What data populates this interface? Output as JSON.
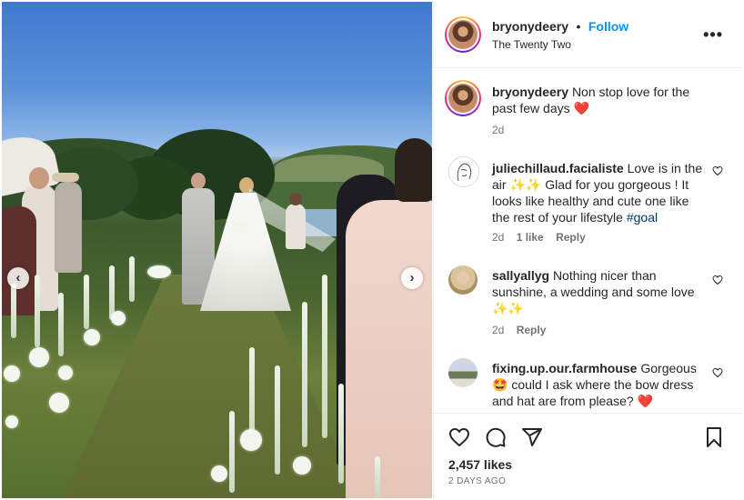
{
  "post": {
    "username": "bryonydeery",
    "separator": "•",
    "follow_label": "Follow",
    "location": "The Twenty Two",
    "more_label": "•••",
    "caption_text": "Non stop love for the past few days",
    "caption_emoji": "❤️",
    "caption_time": "2d"
  },
  "comments": [
    {
      "username": "juliechillaud.facialiste",
      "text": "Love is in the air ✨✨ Glad for you gorgeous ! It looks like healthy and cute one like the rest of your lifestyle",
      "hashtag": "#goal",
      "time": "2d",
      "likes": "1 like",
      "reply": "Reply"
    },
    {
      "username": "sallyallyg",
      "text": "Nothing nicer than sunshine, a wedding and some love ✨✨",
      "time": "2d",
      "reply": "Reply"
    },
    {
      "username": "fixing.up.our.farmhouse",
      "text": "Gorgeous 🤩 could I ask where the bow dress and hat are from please?",
      "emoji": "❤️"
    }
  ],
  "footer": {
    "likes": "2,457 likes",
    "date": "2 DAYS AGO"
  },
  "icons": [
    "more-icon",
    "heart-icon",
    "comment-icon",
    "share-icon",
    "save-icon",
    "chevron-left-icon",
    "chevron-right-icon"
  ],
  "colors": {
    "follow": "#0095f6",
    "hashtag": "#00376b",
    "heart": "#ed4956",
    "muted": "#737373"
  },
  "carousel": {
    "prev_label": "‹",
    "next_label": "›"
  }
}
